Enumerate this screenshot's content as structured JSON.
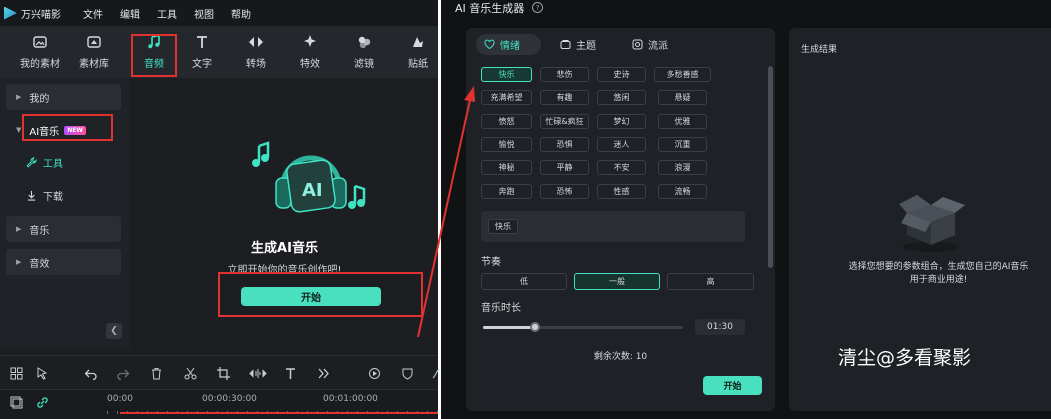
{
  "left_app": {
    "name": "万兴喵影",
    "menu": [
      "文件",
      "编辑",
      "工具",
      "视图",
      "帮助"
    ],
    "toolbar": [
      {
        "label": "我的素材",
        "icon": "media-icon"
      },
      {
        "label": "素材库",
        "icon": "library-icon"
      },
      {
        "label": "音频",
        "icon": "music-note-icon",
        "active": true
      },
      {
        "label": "文字",
        "icon": "text-icon"
      },
      {
        "label": "转场",
        "icon": "transition-icon"
      },
      {
        "label": "特效",
        "icon": "effects-icon"
      },
      {
        "label": "滤镜",
        "icon": "filter-icon"
      },
      {
        "label": "贴纸",
        "icon": "sticker-icon"
      }
    ],
    "sidebar": {
      "mine": "我的",
      "ai_music": "AI音乐",
      "new_badge": "NEW",
      "tools": "工具",
      "download": "下载",
      "music": "音乐",
      "sound_effects": "音效"
    },
    "main": {
      "ai_badge": "AI",
      "title": "生成AI音乐",
      "subtitle": "立即开始你的音乐创作吧!",
      "start": "开始"
    },
    "timeline": {
      "ticks": [
        "00:00",
        "00:00:30:00",
        "00:01:00:00"
      ]
    }
  },
  "generator": {
    "title": "AI 音乐生成器",
    "tabs": [
      {
        "label": "情绪",
        "active": true
      },
      {
        "label": "主题",
        "active": false
      },
      {
        "label": "流派",
        "active": false
      }
    ],
    "moods": [
      [
        "快乐",
        "悲伤",
        "史诗",
        "多愁善感"
      ],
      [
        "充满希望",
        "有趣",
        "悠闲",
        "悬疑"
      ],
      [
        "愤怒",
        "忙碌&疯狂",
        "梦幻",
        "优雅"
      ],
      [
        "愉悦",
        "恐惧",
        "迷人",
        "沉重"
      ],
      [
        "神秘",
        "平静",
        "不安",
        "浪漫"
      ],
      [
        "奔跑",
        "恐怖",
        "性感",
        "流畅"
      ]
    ],
    "selected_mood": "快乐",
    "tempo_label": "节奏",
    "tempo_options": [
      "低",
      "一般",
      "高"
    ],
    "tempo_selected": "一般",
    "duration_label": "音乐时长",
    "duration_value": "01:30",
    "duration_fraction": 0.26,
    "remaining": "剩余次数: 10",
    "start": "开始"
  },
  "result": {
    "title": "生成结果",
    "empty_text_line1": "选择您想要的参数组合，生成您自己的AI音乐",
    "empty_text_line2": "用于商业用途!"
  },
  "watermark": "清尘@多看聚影",
  "colors": {
    "accent": "#49e0bf",
    "annotation_red": "#e0332f",
    "panel": "#1e2125"
  }
}
